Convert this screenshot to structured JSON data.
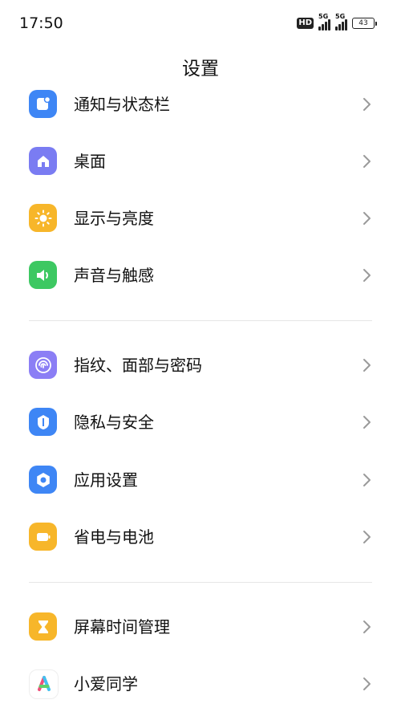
{
  "status_bar": {
    "time": "17:50",
    "hd_badge": "HD",
    "sim1_network": "5G",
    "sim2_network": "5G",
    "battery_level": "43"
  },
  "page": {
    "title": "设置"
  },
  "items": [
    {
      "label": "通知与状态栏",
      "icon": "notification-icon",
      "color": "#3e86f5"
    },
    {
      "label": "桌面",
      "icon": "home-icon",
      "color": "#7a7cf2"
    },
    {
      "label": "显示与亮度",
      "icon": "sun-icon",
      "color": "#f7b62a"
    },
    {
      "label": "声音与触感",
      "icon": "speaker-icon",
      "color": "#3dc862"
    },
    {
      "label": "指纹、面部与密码",
      "icon": "fingerprint-icon",
      "color": "#8b7ef5"
    },
    {
      "label": "隐私与安全",
      "icon": "shield-icon",
      "color": "#3e86f5"
    },
    {
      "label": "应用设置",
      "icon": "gear-icon",
      "color": "#3e86f5"
    },
    {
      "label": "省电与电池",
      "icon": "battery-icon",
      "color": "#f7b62a"
    },
    {
      "label": "屏幕时间管理",
      "icon": "hourglass-icon",
      "color": "#f7b62a"
    },
    {
      "label": "小爱同学",
      "icon": "assistant-icon",
      "color": "#ffffff"
    }
  ]
}
